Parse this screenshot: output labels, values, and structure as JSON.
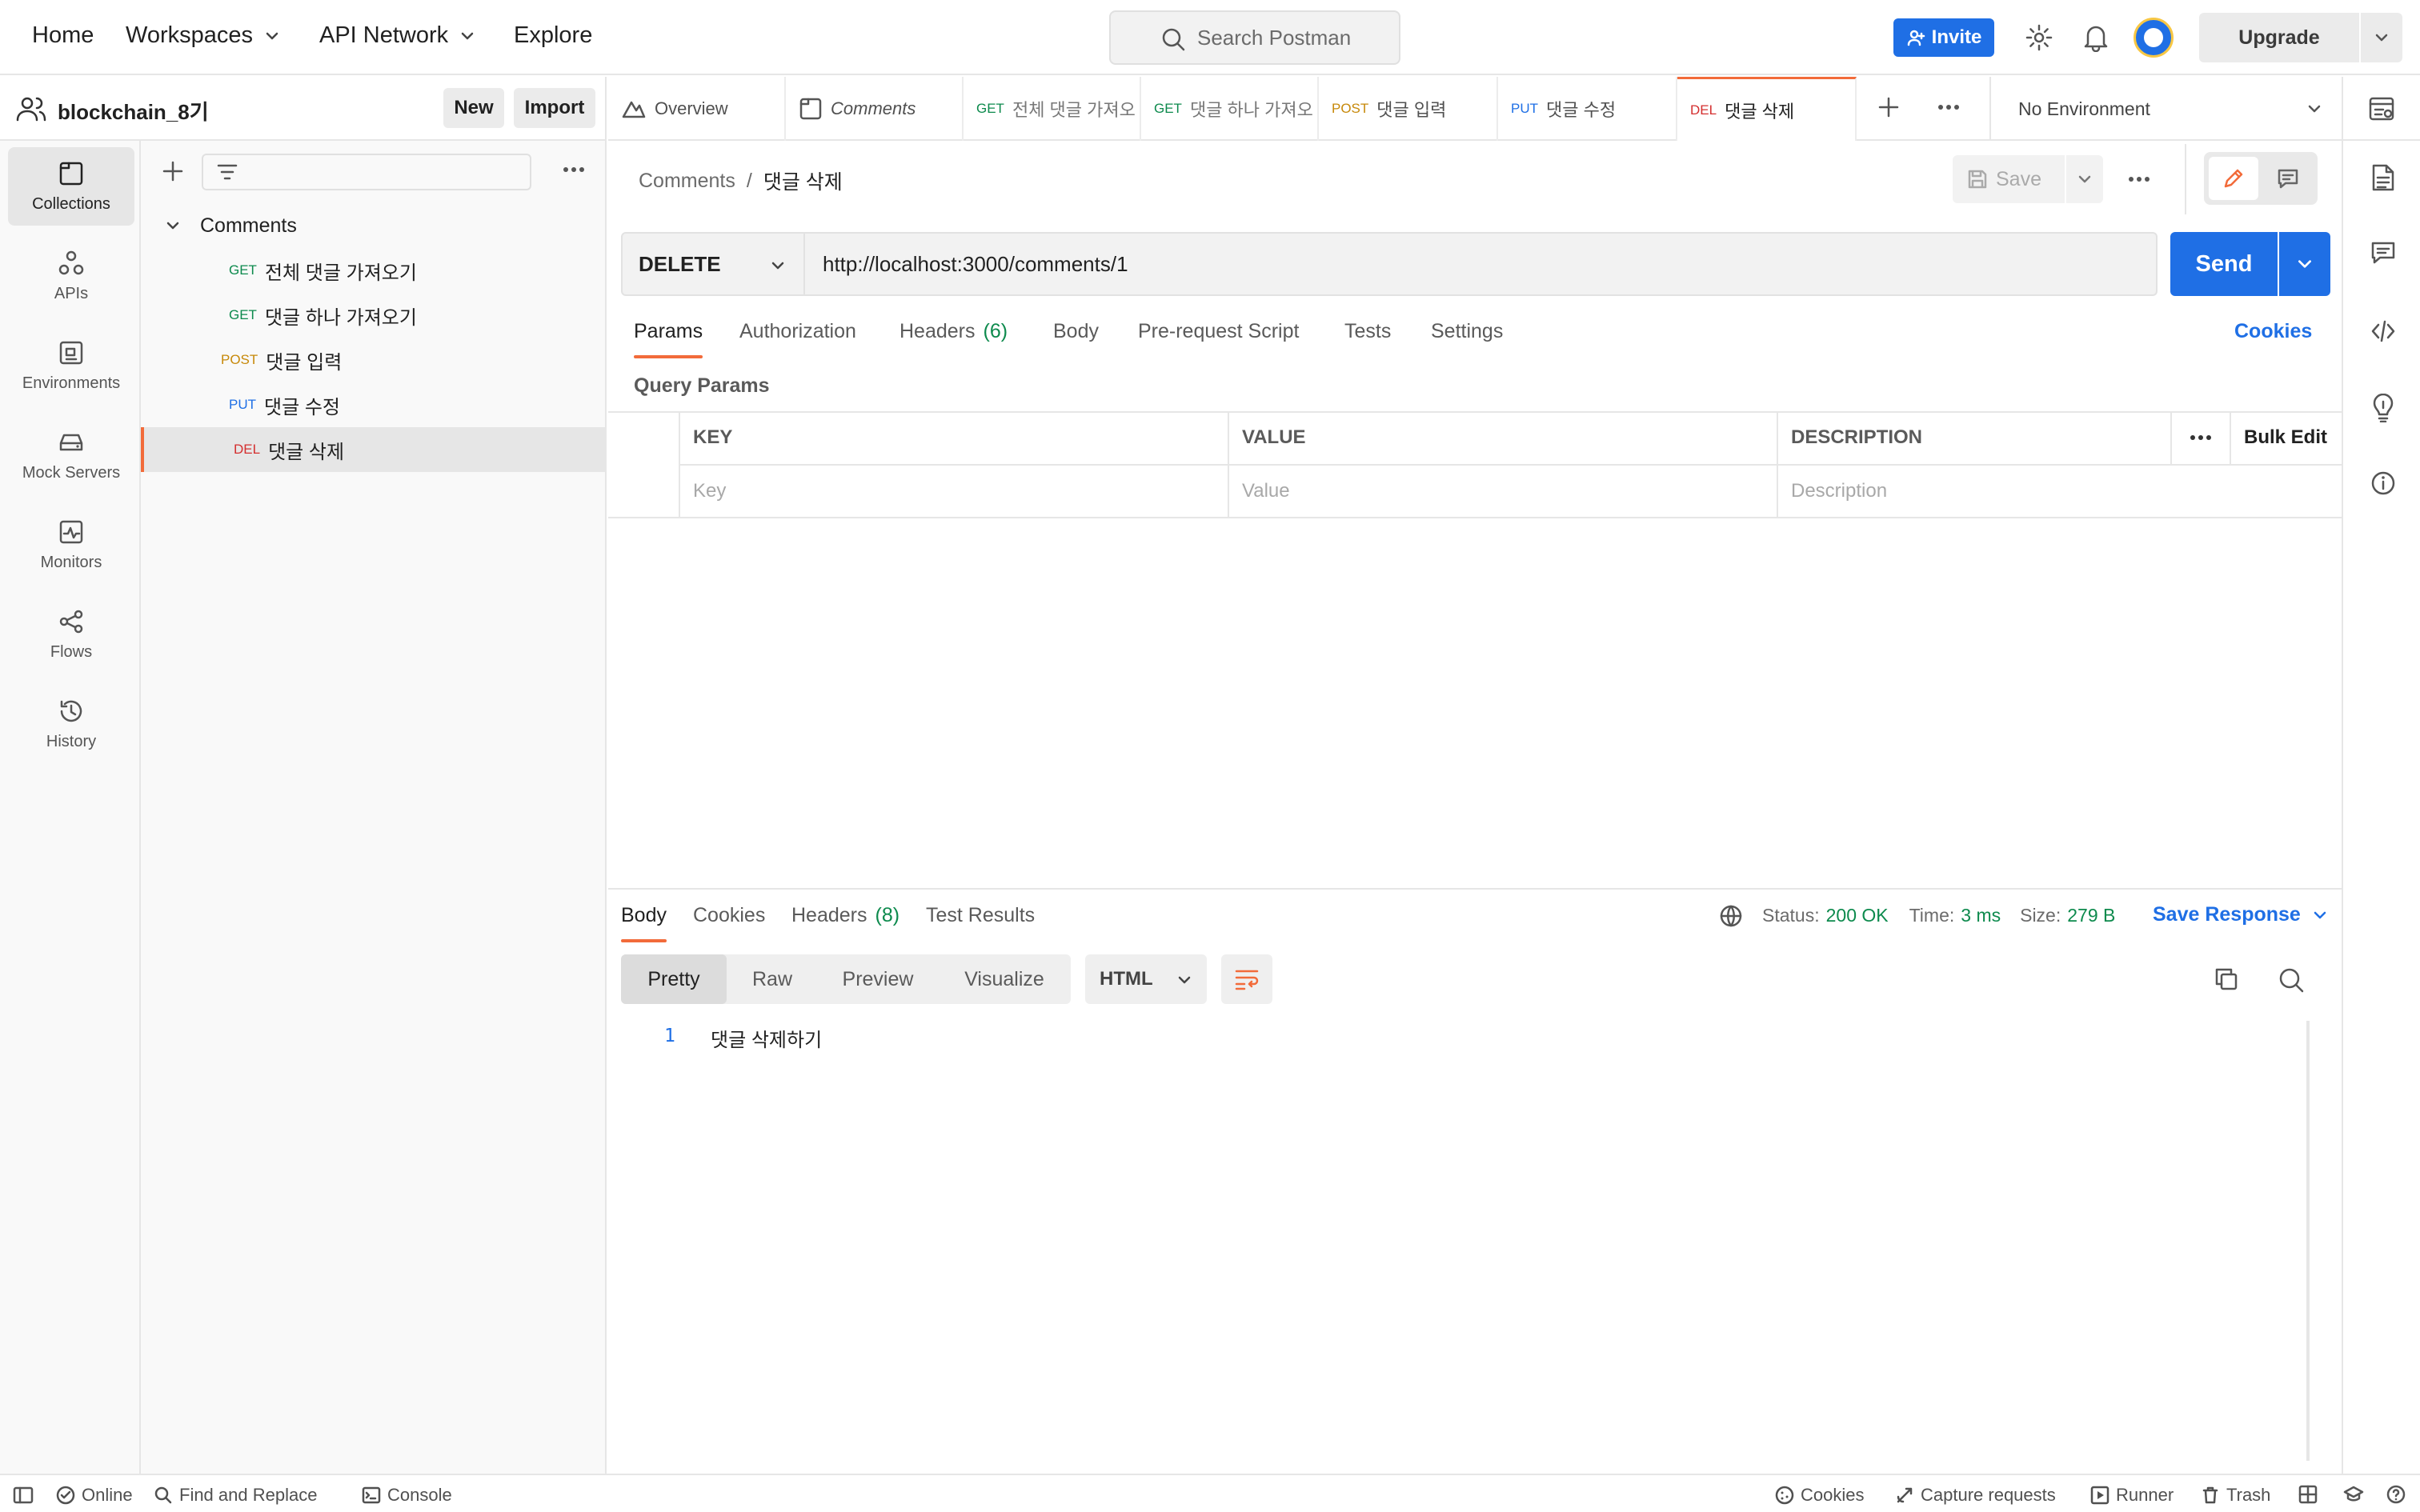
{
  "topbar": {
    "nav": [
      "Home",
      "Workspaces",
      "API Network",
      "Explore"
    ],
    "search_placeholder": "Search Postman",
    "invite_label": "Invite",
    "upgrade_label": "Upgrade"
  },
  "workspace": {
    "name": "blockchain_8기",
    "new_label": "New",
    "import_label": "Import"
  },
  "rail": [
    {
      "label": "Collections",
      "icon": "collections-icon"
    },
    {
      "label": "APIs",
      "icon": "apis-icon"
    },
    {
      "label": "Environments",
      "icon": "environments-icon"
    },
    {
      "label": "Mock Servers",
      "icon": "mock-servers-icon"
    },
    {
      "label": "Monitors",
      "icon": "monitors-icon"
    },
    {
      "label": "Flows",
      "icon": "flows-icon"
    },
    {
      "label": "History",
      "icon": "history-icon"
    }
  ],
  "collection": {
    "name": "Comments",
    "requests": [
      {
        "method": "GET",
        "name": "전체 댓글 가져오기"
      },
      {
        "method": "GET",
        "name": "댓글 하나 가져오기"
      },
      {
        "method": "POST",
        "name": "댓글 입력"
      },
      {
        "method": "PUT",
        "name": "댓글 수정"
      },
      {
        "method": "DEL",
        "name": "댓글 삭제"
      }
    ]
  },
  "tabs": [
    {
      "method": "",
      "name": "Overview"
    },
    {
      "method": "",
      "name": "Comments"
    },
    {
      "method": "GET",
      "name": "전체 댓글 가져오"
    },
    {
      "method": "GET",
      "name": "댓글 하나 가져오"
    },
    {
      "method": "POST",
      "name": "댓글 입력"
    },
    {
      "method": "PUT",
      "name": "댓글 수정"
    },
    {
      "method": "DEL",
      "name": "댓글 삭제"
    }
  ],
  "environment": "No Environment",
  "breadcrumb": {
    "parent": "Comments",
    "sep": "/",
    "current": "댓글 삭제"
  },
  "save_label": "Save",
  "request": {
    "method": "DELETE",
    "url": "http://localhost:3000/comments/1",
    "send_label": "Send"
  },
  "request_tabs": [
    "Params",
    "Authorization",
    "Headers",
    "Body",
    "Pre-request Script",
    "Tests",
    "Settings"
  ],
  "headers_count": "(6)",
  "cookies_link": "Cookies",
  "query_params_title": "Query Params",
  "params_table": {
    "headers": [
      "KEY",
      "VALUE",
      "DESCRIPTION"
    ],
    "bulk_edit": "Bulk Edit",
    "placeholders": [
      "Key",
      "Value",
      "Description"
    ]
  },
  "response": {
    "tabs": [
      "Body",
      "Cookies",
      "Headers",
      "Test Results"
    ],
    "headers_count": "(8)",
    "status_label": "Status:",
    "status_value": "200 OK",
    "time_label": "Time:",
    "time_value": "3 ms",
    "size_label": "Size:",
    "size_value": "279 B",
    "save_response": "Save Response",
    "views": [
      "Pretty",
      "Raw",
      "Preview",
      "Visualize"
    ],
    "format": "HTML",
    "line_number": "1",
    "body_text": "댓글 삭제하기"
  },
  "statusbar": {
    "online": "Online",
    "find_replace": "Find and Replace",
    "console": "Console",
    "cookies": "Cookies",
    "capture": "Capture requests",
    "runner": "Runner",
    "trash": "Trash"
  },
  "colors": {
    "accent": "#f26b3a",
    "primary": "#1f6fe5",
    "get": "#0d8a4d",
    "post": "#c7890a",
    "put": "#1f6fe5",
    "del": "#d42f2f"
  }
}
